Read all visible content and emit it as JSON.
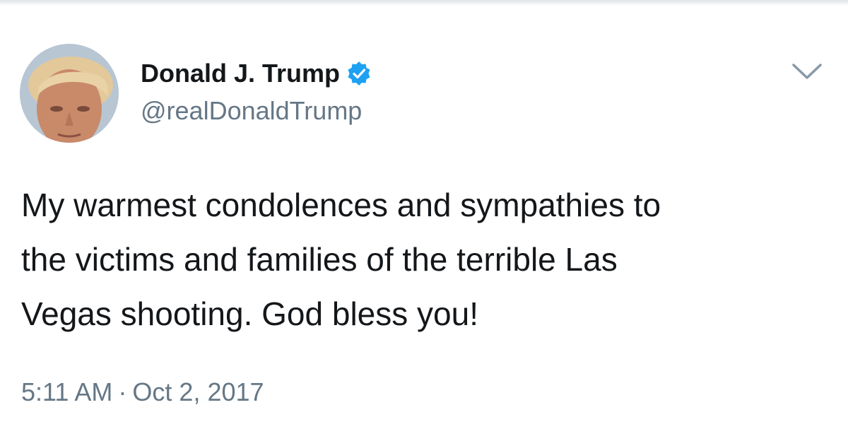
{
  "author": {
    "display_name": "Donald J. Trump",
    "handle": "@realDonaldTrump",
    "verified": true,
    "verified_color": "#1da1f2"
  },
  "tweet": {
    "lines": [
      "My warmest condolences and sympathies to",
      "the victims and families of the terrible Las",
      "Vegas shooting. God bless you!"
    ],
    "time": "5:11 AM",
    "separator": "·",
    "date": "Oct 2, 2017"
  },
  "icons": {
    "verified": "verified-badge-icon",
    "menu": "chevron-down-icon"
  },
  "colors": {
    "text": "#14171a",
    "secondary": "#657786",
    "background": "#ffffff"
  }
}
